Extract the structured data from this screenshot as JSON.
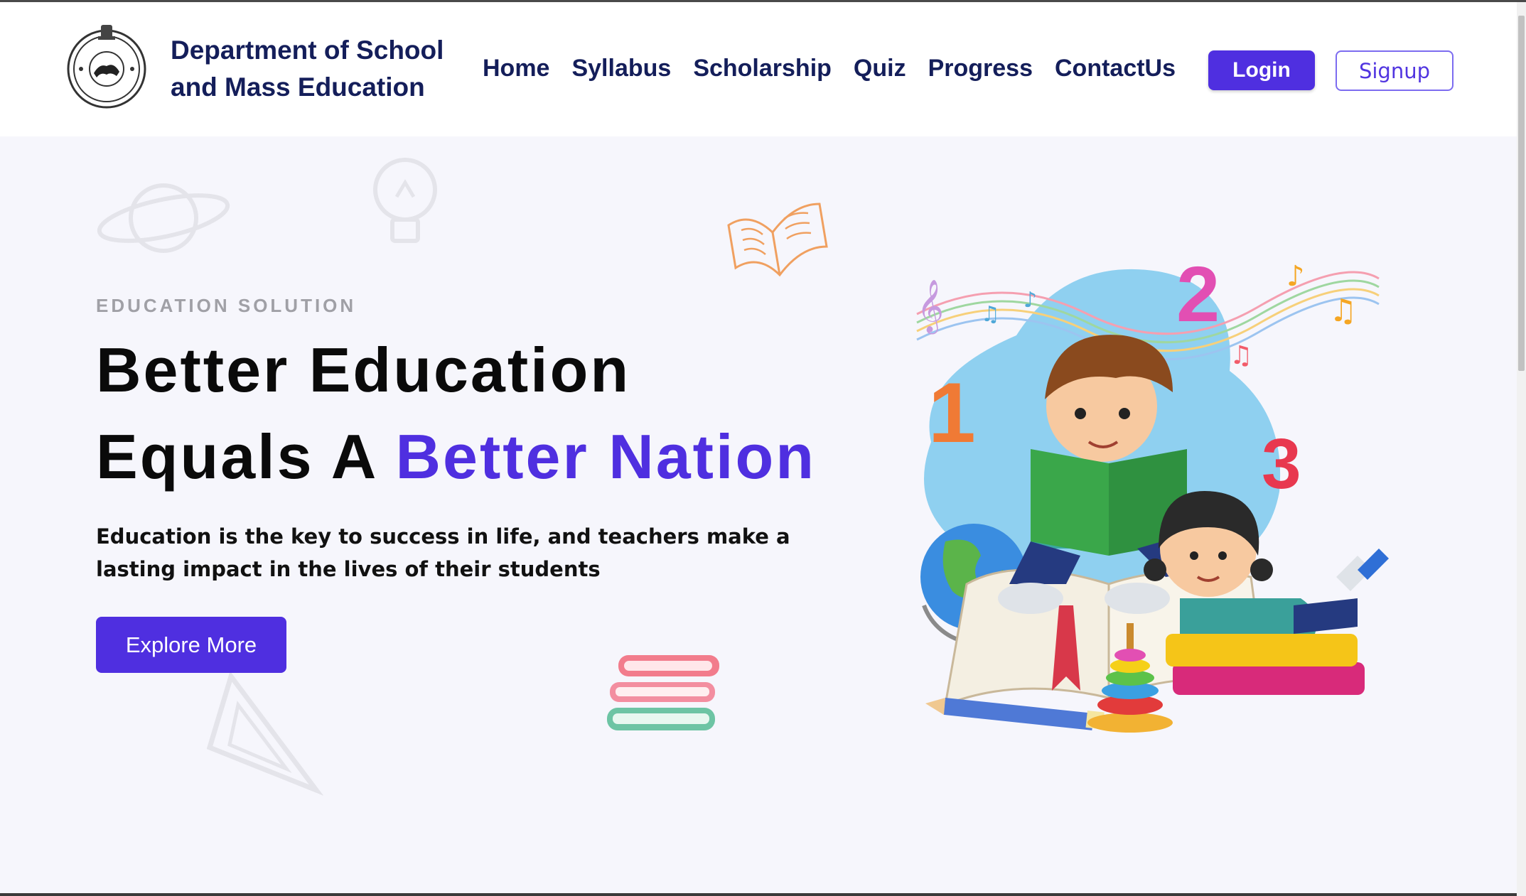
{
  "header": {
    "brand_line1": "Department of School",
    "brand_line2": "and Mass Education",
    "logo_icon": "state-emblem-seal-icon",
    "nav": [
      "Home",
      "Syllabus",
      "Scholarship",
      "Quiz",
      "Progress",
      "ContactUs"
    ],
    "login_label": "Login",
    "signup_label": "Signup"
  },
  "hero": {
    "eyebrow": "EDUCATION SOLUTION",
    "headline_line1": "Better Education",
    "headline_line2_plain": "Equals A ",
    "headline_line2_accent": "Better Nation",
    "description": "Education is the key to success in life, and teachers make a lasting impact in the lives of their students",
    "cta_label": "Explore More",
    "illustration": "children-reading-books-illustration"
  },
  "colors": {
    "accent": "#4f2fe0",
    "nav_text": "#141e5a",
    "hero_bg": "#f6f6fc"
  }
}
